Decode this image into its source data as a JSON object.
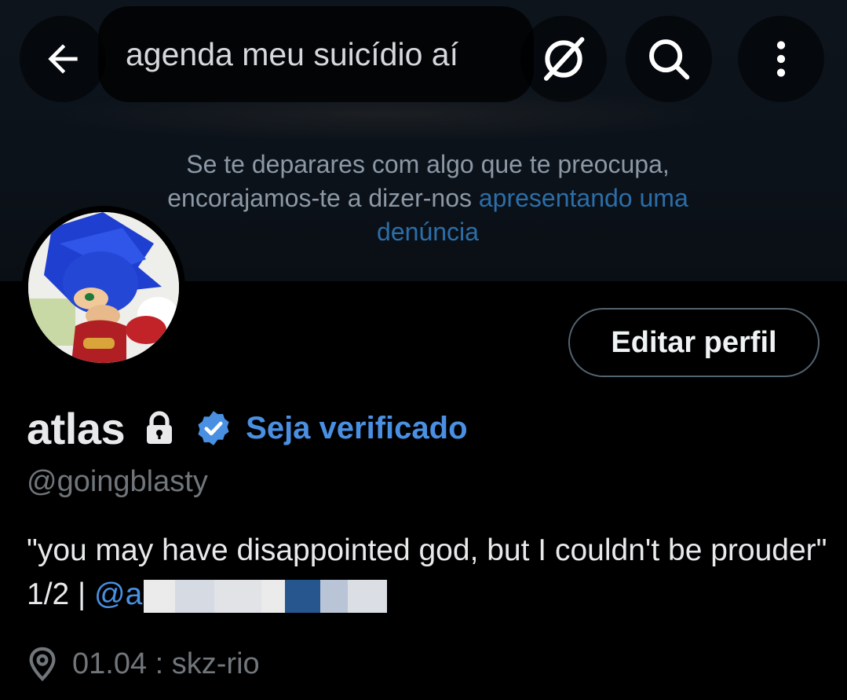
{
  "search": {
    "query": "agenda meu suicídio aí"
  },
  "banner": {
    "notice_text": "Se te deparares com algo que te preocupa, encorajamos-te a dizer-nos",
    "notice_link": "apresentando uma denúncia"
  },
  "profile": {
    "edit_button_label": "Editar perfil",
    "display_name": "atlas",
    "verify_link": "Seja verificado",
    "handle": "@goingblasty",
    "bio_text": "\"you may have disappointed god, but I couldn't be prouder\" 1/2 | ",
    "bio_mention": "@a",
    "location": "01.04 : skz-rio"
  },
  "icons": {
    "back": "arrow-left-icon",
    "clear": "circle-slash-icon",
    "search": "search-icon",
    "more": "more-vertical-icon",
    "lock": "lock-icon",
    "verified": "verified-badge-icon",
    "location": "location-pin-icon"
  },
  "colors": {
    "background": "#000000",
    "accent_link": "#4a90e2",
    "banner_link": "#2b6ea8",
    "muted_text": "#71767b",
    "primary_text": "#e7e9ea",
    "verified_badge": "#4a90e2"
  }
}
